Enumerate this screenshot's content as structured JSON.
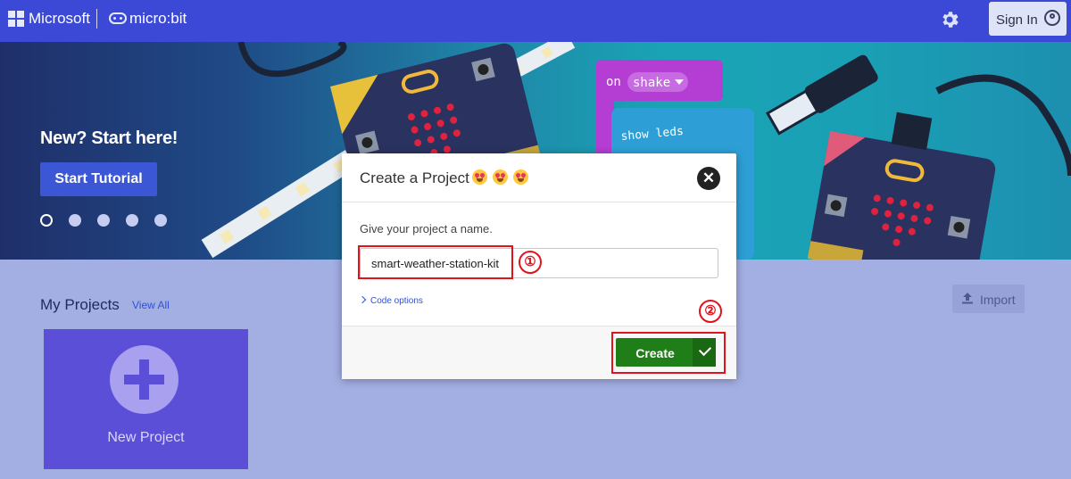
{
  "header": {
    "brand": "Microsoft",
    "product": "micro:bit",
    "settings_icon": "gear-icon",
    "signin_label": "Sign In",
    "signin_icon": "user-circle-icon"
  },
  "hero": {
    "title": "New? Start here!",
    "start_tutorial": "Start Tutorial",
    "carousel": {
      "count": 5,
      "active": 1
    },
    "blocks": {
      "on": "on",
      "shake": "shake",
      "show_leds": "show leds"
    }
  },
  "main": {
    "my_projects": "My Projects",
    "view_all": "View All",
    "import_label": "Import",
    "new_project_label": "New Project"
  },
  "modal": {
    "title": "Create a Project",
    "title_emoji": "smiling-face-with-heart-eyes",
    "prompt": "Give your project a name.",
    "name_value": "smart-weather-station-kit",
    "code_options": "Code options",
    "create_label": "Create",
    "close_icon": "close-icon"
  },
  "annotations": {
    "step1": "①",
    "step2": "②"
  },
  "colors": {
    "header": "#3b49d6",
    "page": "#a3aee3",
    "new_project_card": "#5b4fd8",
    "create_button": "#1f7e17",
    "highlight": "#e0131d"
  }
}
